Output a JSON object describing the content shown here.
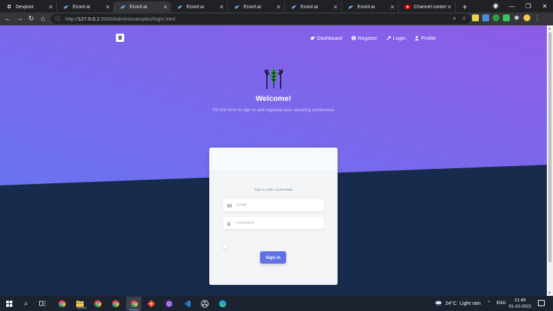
{
  "browser": {
    "tabs": [
      {
        "title": "Devpost",
        "favicon": "devpost-icon",
        "active": false
      },
      {
        "title": "Econf.ai",
        "favicon": "econf-icon",
        "active": false
      },
      {
        "title": "Econf.ai",
        "favicon": "econf-icon",
        "active": true
      },
      {
        "title": "Econf.ai",
        "favicon": "econf-icon",
        "active": false
      },
      {
        "title": "Econf.ai",
        "favicon": "econf-icon",
        "active": false
      },
      {
        "title": "Econf.ai",
        "favicon": "econf-icon",
        "active": false
      },
      {
        "title": "Econf.ai",
        "favicon": "econf-icon",
        "active": false
      },
      {
        "title": "Channel content",
        "favicon": "youtube-icon",
        "active": false
      }
    ],
    "url_host": "127.0.0.1",
    "url_rest": ":5500/Admin/examples/login.html",
    "url_scheme": "http://"
  },
  "page": {
    "nav": {
      "dashboard": "Dashboard",
      "register": "Register",
      "login": "Login",
      "profile": "Profile"
    },
    "welcome_title": "Welcome!",
    "welcome_lead": "Fill this form to sign in and organise your amazing conference",
    "card": {
      "credentials_text": "Sign in with credentials",
      "email_placeholder": "Email",
      "password_placeholder": "Password",
      "signin_label": "Sign in"
    },
    "colors": {
      "gradient_start": "#6a6ff0",
      "gradient_end": "#8a5ee6",
      "dark_section": "#172b4d",
      "primary_button": "#5e72e4"
    }
  },
  "taskbar": {
    "weather_temp": "24°C",
    "weather_desc": "Light rain",
    "lang": "ENG",
    "time": "21:49",
    "date": "01-10-2021"
  }
}
